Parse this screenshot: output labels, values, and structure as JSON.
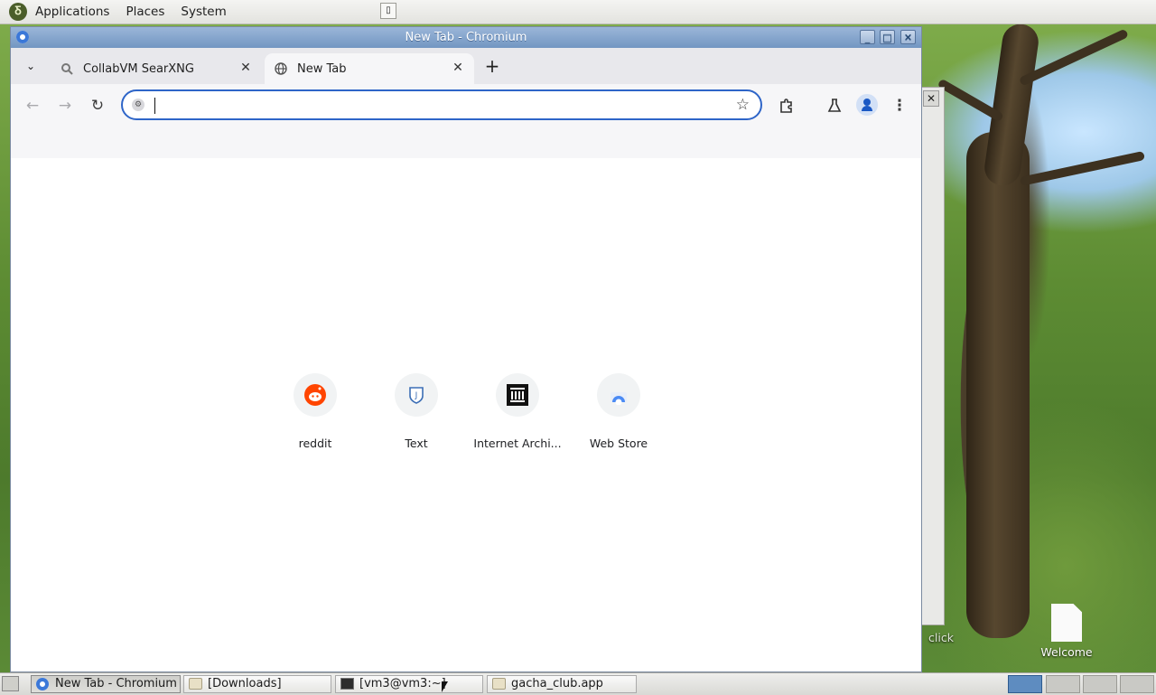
{
  "top_panel": {
    "menus": [
      "Applications",
      "Places",
      "System"
    ]
  },
  "desktop": {
    "icons": [
      {
        "label": "Welcome"
      },
      {
        "label": "click"
      }
    ]
  },
  "browser": {
    "window_title": "New Tab - Chromium",
    "tabs": [
      {
        "title": "CollabVM SearXNG",
        "active": false
      },
      {
        "title": "New Tab",
        "active": true
      }
    ],
    "omnibox": {
      "value": "",
      "placeholder": ""
    },
    "shortcuts": [
      {
        "label": "reddit",
        "icon": "reddit-icon"
      },
      {
        "label": "Text",
        "icon": "text-icon"
      },
      {
        "label": "Internet Archi...",
        "icon": "internet-archive-icon"
      },
      {
        "label": "Web Store",
        "icon": "web-store-icon"
      }
    ]
  },
  "taskbar": {
    "tasks": [
      {
        "label": "New Tab - Chromium",
        "icon": "chromium-icon",
        "active": true
      },
      {
        "label": "[Downloads]",
        "icon": "folder-icon",
        "active": false
      },
      {
        "label": "[vm3@vm3:~]",
        "icon": "terminal-icon",
        "active": false
      },
      {
        "label": "gacha_club.app",
        "icon": "folder-icon",
        "active": false
      }
    ]
  },
  "colors": {
    "accent": "#2e65c8",
    "titlebar": "#7c9dc8",
    "reddit": "#ff4500"
  }
}
